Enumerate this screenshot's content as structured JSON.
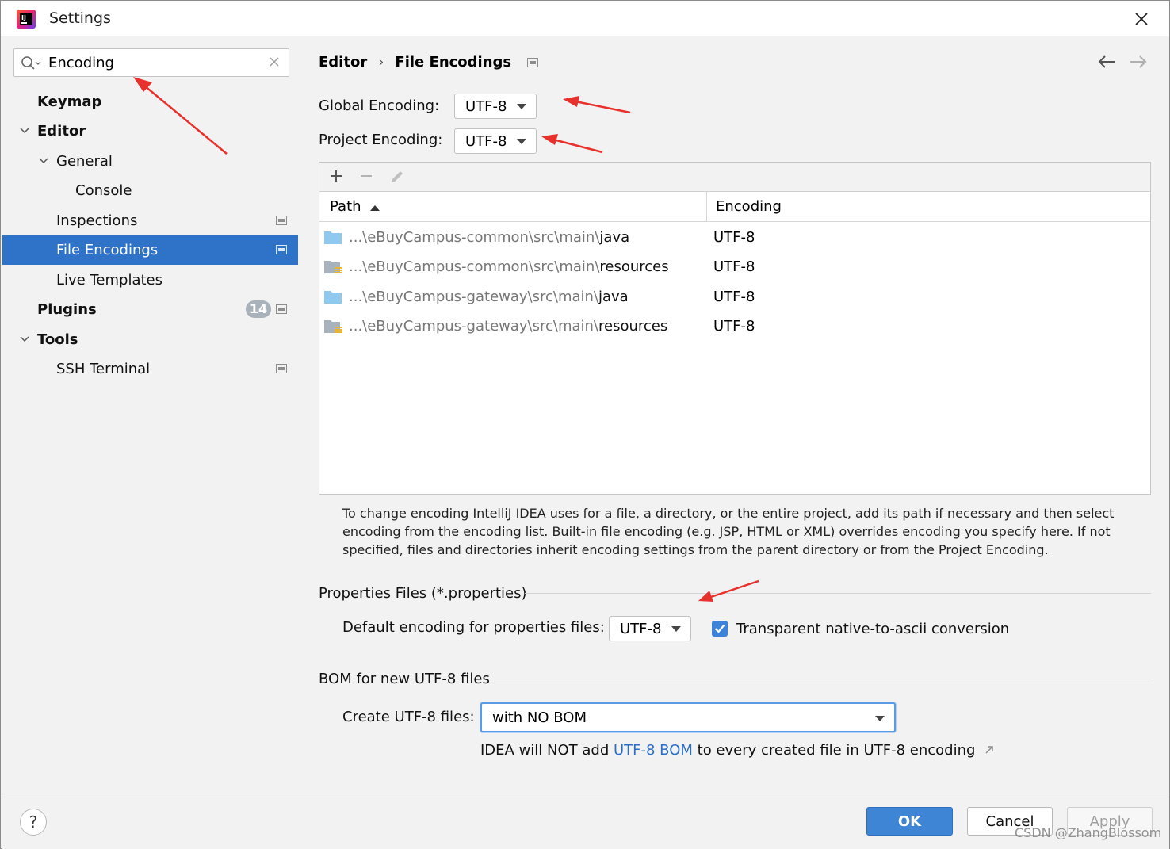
{
  "window": {
    "title": "Settings",
    "icons": {
      "app": "intellij-idea-icon",
      "close": "close-icon"
    }
  },
  "search": {
    "value": "Encoding",
    "placeholder": ""
  },
  "sidebar": {
    "items": [
      {
        "label": "Keymap"
      },
      {
        "label": "Editor"
      },
      {
        "label": "General"
      },
      {
        "label": "Console"
      },
      {
        "label": "Inspections"
      },
      {
        "label": "File Encodings",
        "selected": true
      },
      {
        "label": "Live Templates"
      },
      {
        "label": "Plugins",
        "badge": "14"
      },
      {
        "label": "Tools"
      },
      {
        "label": "SSH Terminal"
      }
    ]
  },
  "breadcrumb": {
    "parent": "Editor",
    "separator": "›",
    "current": "File Encodings"
  },
  "encodings": {
    "global_label": "Global Encoding:",
    "global_value": "UTF-8",
    "project_label": "Project Encoding:",
    "project_value": "UTF-8"
  },
  "table": {
    "columns": [
      "Path",
      "Encoding"
    ],
    "rows": [
      {
        "path_prefix": "...\\eBuyCampus-common\\src\\main\\",
        "path_last": "java",
        "encoding": "UTF-8",
        "icon": "folder-icon"
      },
      {
        "path_prefix": "...\\eBuyCampus-common\\src\\main\\",
        "path_last": "resources",
        "encoding": "UTF-8",
        "icon": "resources-folder-icon"
      },
      {
        "path_prefix": "...\\eBuyCampus-gateway\\src\\main\\",
        "path_last": "java",
        "encoding": "UTF-8",
        "icon": "folder-icon"
      },
      {
        "path_prefix": "...\\eBuyCampus-gateway\\src\\main\\",
        "path_last": "resources",
        "encoding": "UTF-8",
        "icon": "resources-folder-icon"
      }
    ]
  },
  "help_text": "To change encoding IntelliJ IDEA uses for a file, a directory, or the entire project, add its path if necessary and then select encoding from the encoding list. Built-in file encoding (e.g. JSP, HTML or XML) overrides encoding you specify here. If not specified, files and directories inherit encoding settings from the parent directory or from the Project Encoding.",
  "properties": {
    "section_title": "Properties Files (*.properties)",
    "default_label": "Default encoding for properties files:",
    "default_value": "UTF-8",
    "transparent_label": "Transparent native-to-ascii conversion",
    "transparent_checked": true
  },
  "bom": {
    "section_title": "BOM for new UTF-8 files",
    "create_label": "Create UTF-8 files:",
    "create_value": "with NO BOM",
    "note_prefix": "IDEA will NOT add ",
    "note_link": "UTF-8 BOM",
    "note_suffix": " to every created file in UTF-8 encoding"
  },
  "buttons": {
    "help": "?",
    "ok": "OK",
    "cancel": "Cancel",
    "apply": "Apply"
  },
  "watermark": "CSDN @ZhangBlossom",
  "colors": {
    "accent": "#2f73c8",
    "ok_button": "#3f85d6",
    "annotation_arrow": "#e8302c",
    "link": "#2b6fc5"
  }
}
